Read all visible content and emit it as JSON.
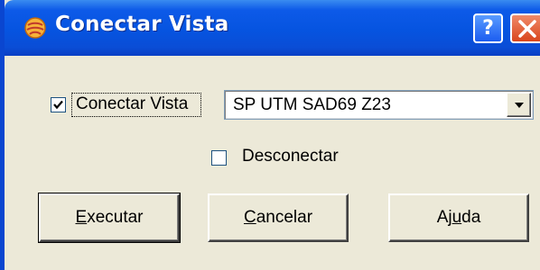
{
  "window": {
    "title": "Conectar Vista",
    "help_label": "?",
    "icons": {
      "app": "app-globe-icon",
      "help": "help-icon",
      "close": "close-icon"
    }
  },
  "form": {
    "connect_checkbox": {
      "label": "Conectar Vista",
      "checked": true
    },
    "projection_select": {
      "value": "SP UTM SAD69 Z23"
    },
    "disconnect_checkbox": {
      "label": "Desconectar",
      "checked": false
    }
  },
  "buttons": {
    "execute": {
      "label_pre": "",
      "label_mnemonic": "E",
      "label_post": "xecutar"
    },
    "cancel": {
      "label_pre": "",
      "label_mnemonic": "C",
      "label_post": "ancelar"
    },
    "help": {
      "label_pre": "Aj",
      "label_mnemonic": "u",
      "label_post": "da"
    }
  },
  "colors": {
    "titlebar": "#0654e0",
    "dialog_bg": "#ece9d8",
    "close_button": "#d9461c"
  }
}
